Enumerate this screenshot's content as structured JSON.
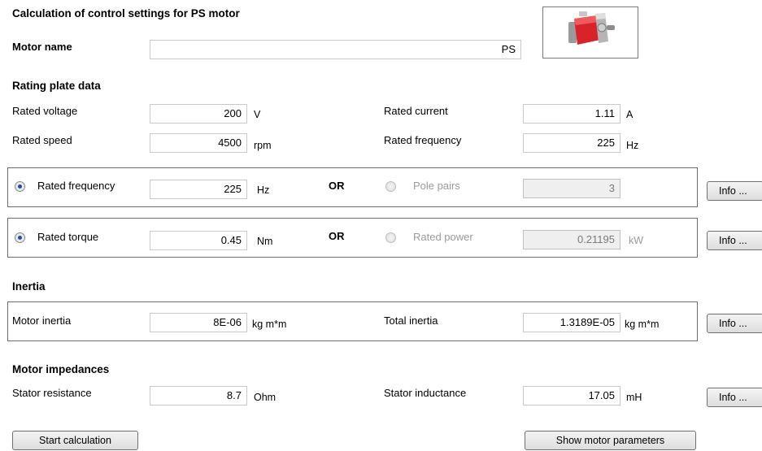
{
  "title": "Calculation of control settings for PS motor",
  "motor_name": {
    "label": "Motor name",
    "value": "PS"
  },
  "rating_plate": {
    "heading": "Rating plate data",
    "rated_voltage": {
      "label": "Rated voltage",
      "value": "200",
      "unit": "V"
    },
    "rated_current": {
      "label": "Rated current",
      "value": "1.11",
      "unit": "A"
    },
    "rated_speed": {
      "label": "Rated speed",
      "value": "4500",
      "unit": "rpm"
    },
    "rated_frequency": {
      "label": "Rated frequency",
      "value": "225",
      "unit": "Hz"
    }
  },
  "freq_group": {
    "option_a": {
      "label": "Rated frequency",
      "value": "225",
      "unit": "Hz",
      "selected": true
    },
    "or_label": "OR",
    "option_b": {
      "label": "Pole pairs",
      "value": "3",
      "selected": false
    },
    "info_label": "Info ..."
  },
  "torque_group": {
    "option_a": {
      "label": "Rated torque",
      "value": "0.45",
      "unit": "Nm",
      "selected": true
    },
    "or_label": "OR",
    "option_b": {
      "label": "Rated power",
      "value": "0.21195",
      "unit": "kW",
      "selected": false
    },
    "info_label": "Info ..."
  },
  "inertia": {
    "heading": "Inertia",
    "motor_inertia": {
      "label": "Motor inertia",
      "value": "8E-06",
      "unit": "kg m*m"
    },
    "total_inertia": {
      "label": "Total inertia",
      "value": "1.3189E-05",
      "unit": "kg m*m"
    },
    "info_label": "Info ..."
  },
  "impedances": {
    "heading": "Motor impedances",
    "stator_resistance": {
      "label": "Stator resistance",
      "value": "8.7",
      "unit": "Ohm"
    },
    "stator_inductance": {
      "label": "Stator inductance",
      "value": "17.05",
      "unit": "mH"
    },
    "info_label": "Info ..."
  },
  "buttons": {
    "start_calculation": "Start calculation",
    "show_motor_parameters": "Show motor parameters"
  },
  "colors": {
    "motor_red": "#d8232a",
    "radio_dot": "#1f4ea8",
    "group_border": "#6d6d6d"
  },
  "icons": {
    "motor_image": "servo-motor-icon"
  }
}
